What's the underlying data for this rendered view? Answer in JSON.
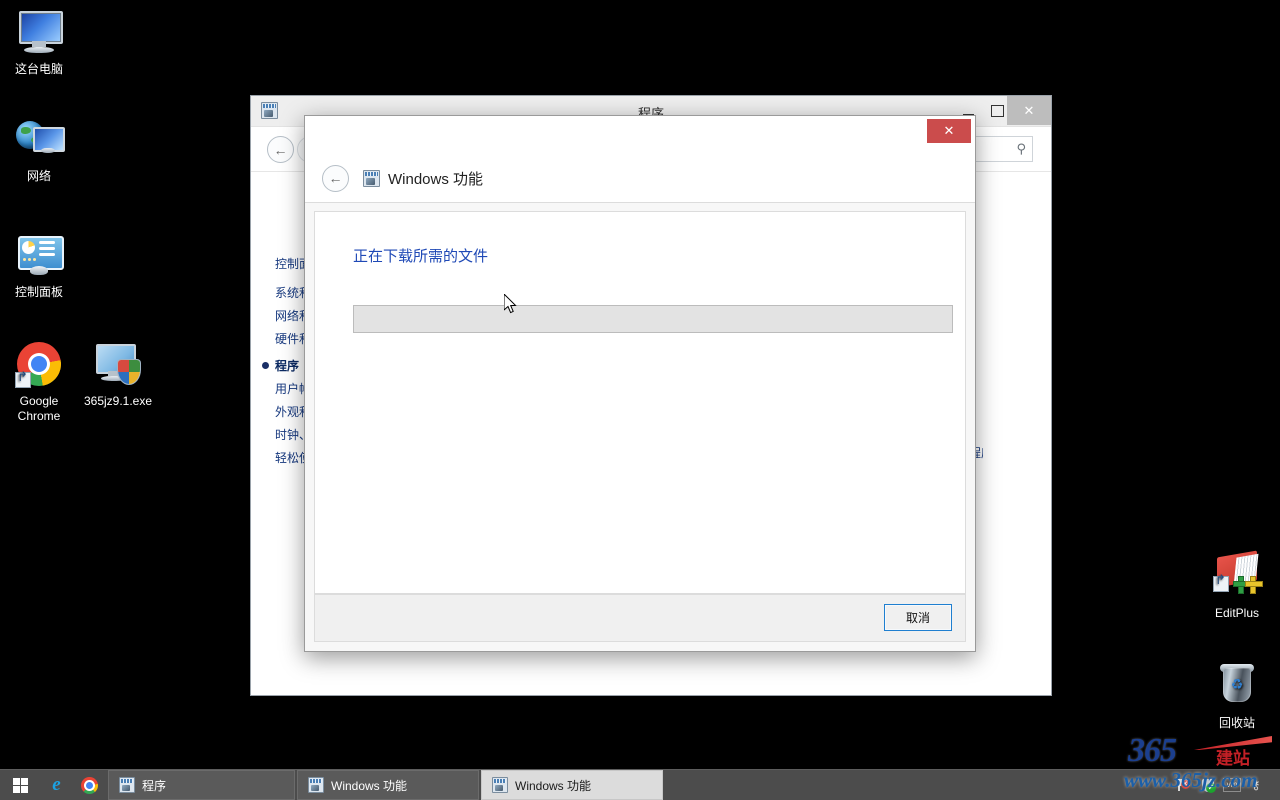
{
  "desktop": {
    "icons": [
      {
        "label": "这台电脑",
        "icon": "computer-icon"
      },
      {
        "label": "网络",
        "icon": "network-icon"
      },
      {
        "label": "控制面板",
        "icon": "control-panel-icon"
      },
      {
        "label": "Google Chrome",
        "icon": "chrome-icon"
      },
      {
        "label": "365jz9.1.exe",
        "icon": "executable-icon"
      },
      {
        "label": "EditPlus",
        "icon": "editplus-icon"
      },
      {
        "label": "回收站",
        "icon": "recycle-bin-icon"
      }
    ]
  },
  "parent_window": {
    "title": "程序",
    "icon": "windows-features-icon",
    "controls": {
      "minimize": "—",
      "maximize": "□",
      "close": "✕"
    },
    "nav": {
      "back": "←",
      "forward": "→",
      "search_icon": "search-icon"
    },
    "sidebar": {
      "items": [
        {
          "label": "控制面板主页",
          "current": false
        },
        {
          "label": "系统和安全",
          "current": false
        },
        {
          "label": "网络和 Internet",
          "current": false
        },
        {
          "label": "硬件和声音",
          "current": false
        },
        {
          "label": "程序",
          "current": true
        },
        {
          "label": "用户帐户",
          "current": false
        },
        {
          "label": "外观和个性化",
          "current": false
        },
        {
          "label": "时钟、语言和区域",
          "current": false
        },
        {
          "label": "轻松使用",
          "current": false
        }
      ]
    },
    "right_link": "程序和功能"
  },
  "dialog": {
    "title": "Windows 功能",
    "icon": "windows-features-icon",
    "back_label": "←",
    "close_label": "✕",
    "close_color": "#cb4c4c",
    "status_text": "正在下载所需的文件",
    "status_color": "#1f49b6",
    "progress": {
      "percent": 0,
      "label": "0%"
    },
    "cancel_label": "取消"
  },
  "taskbar": {
    "start_label": "start-button",
    "quick_launch": [
      {
        "name": "internet-explorer-icon",
        "glyph": "e"
      },
      {
        "name": "chrome-icon",
        "glyph": ""
      }
    ],
    "tasks": [
      {
        "label": "程序",
        "active": false
      },
      {
        "label": "Windows 功能",
        "active": false
      },
      {
        "label": "Windows 功能",
        "active": true
      }
    ],
    "tray": [
      {
        "name": "action-center-flag-icon",
        "badge": "✕"
      },
      {
        "name": "security-shield-icon",
        "badge": "✓"
      },
      {
        "name": "vmware-tools-icon",
        "label": "vm"
      },
      {
        "name": "network-key-icon",
        "label": "⚷"
      }
    ]
  },
  "watermark": {
    "number": "365",
    "suffix": "建站",
    "url": "www.365jz.com"
  }
}
